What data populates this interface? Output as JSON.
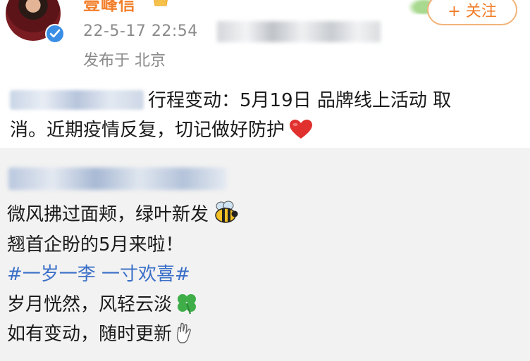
{
  "post": {
    "username": "壹峰信",
    "timestamp": "22-5-17 22:54",
    "location": "发布于 北京",
    "follow_label": "+ 关注",
    "text_line1": "行程变动：5月19日 品牌线上活动 取",
    "text_line2": "消。近期疫情反复，切记做好防护",
    "icons": [
      "verified-icon",
      "crown-icon",
      "heart-icon"
    ]
  },
  "repost": {
    "lines": [
      "微风拂过面颊，绿叶新发",
      "翘首企盼的5月来啦！",
      "#一岁一李 一寸欢喜#",
      "岁月恍然，风轻云淡",
      "如有变动，随时更新"
    ],
    "icons": [
      "bee-icon",
      "clover-icon",
      "hand-icon"
    ],
    "hashtag_color": "#3a6fc7"
  },
  "colors": {
    "username": "#f37f2a",
    "follow_border": "#f2b37a",
    "meta_text": "#8a8a8a",
    "repost_bg": "#f2f2f2"
  }
}
